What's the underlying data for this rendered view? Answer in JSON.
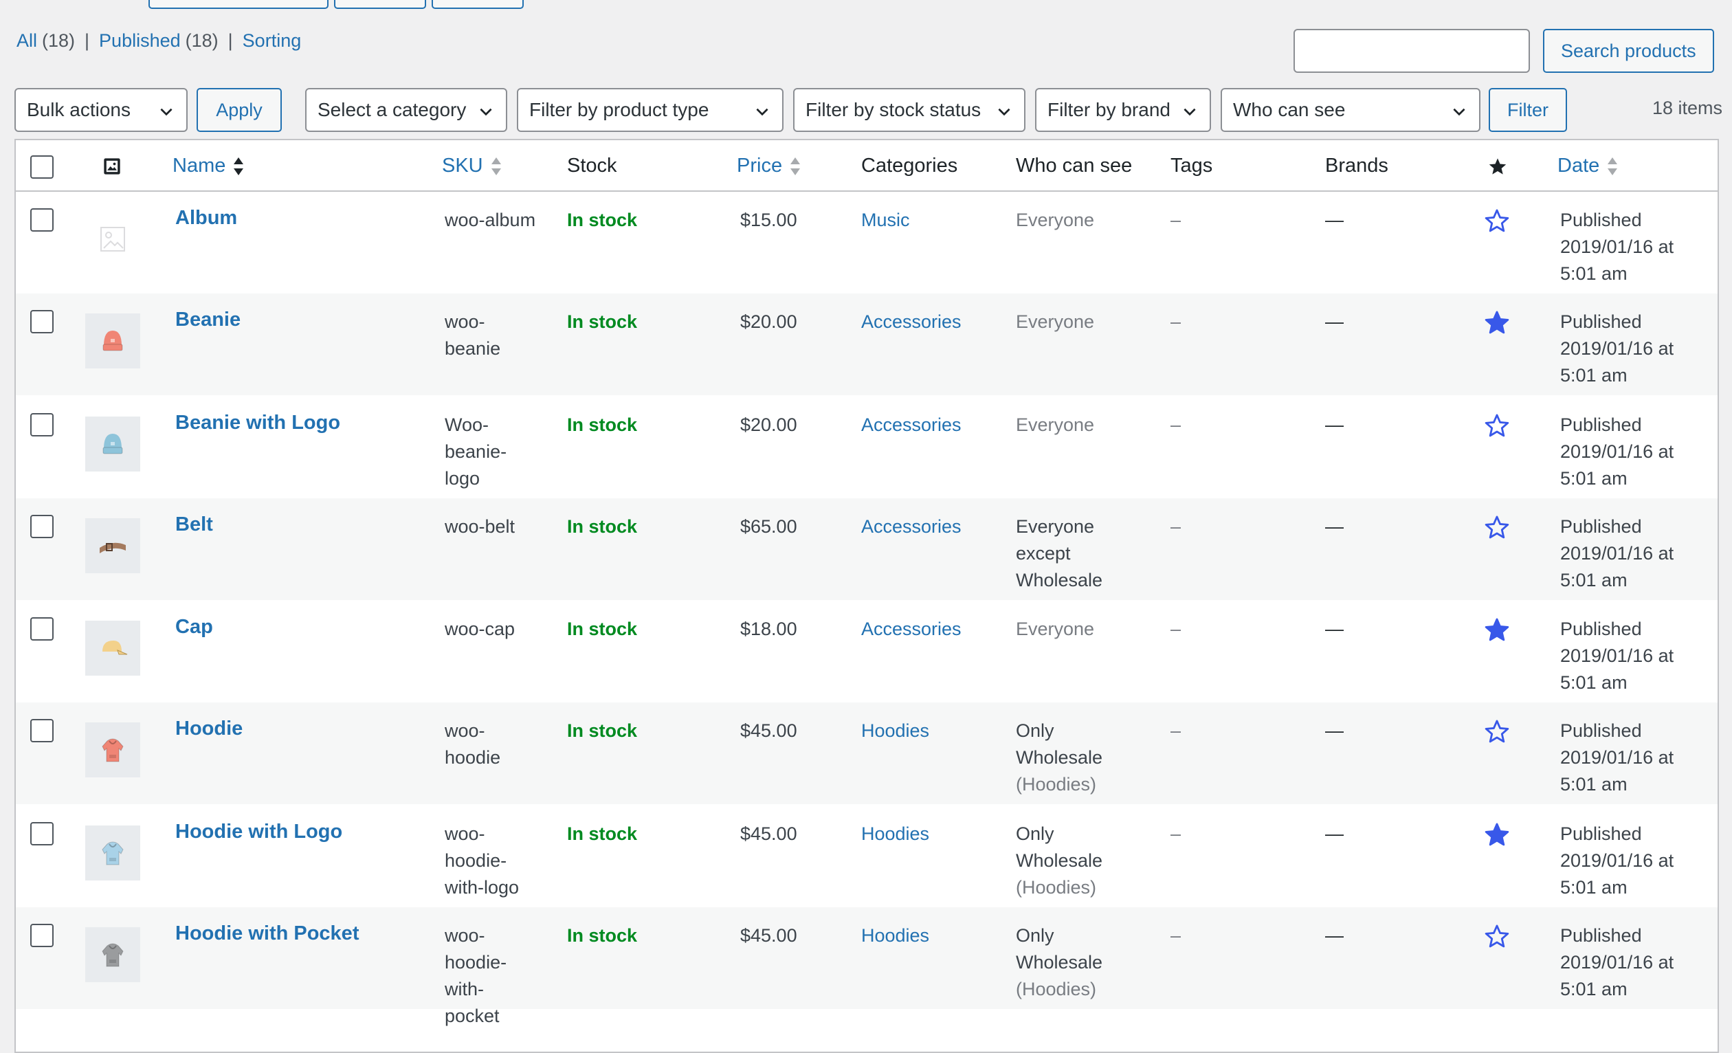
{
  "views": [
    {
      "label": "All",
      "count": "(18)"
    },
    {
      "label": "Published",
      "count": "(18)"
    },
    {
      "label": "Sorting",
      "count": ""
    }
  ],
  "separator": "|",
  "search": {
    "value": "",
    "button": "Search products"
  },
  "filters": {
    "bulk": "Bulk actions",
    "apply": "Apply",
    "category": "Select a category",
    "product_type": "Filter by product type",
    "stock_status": "Filter by stock status",
    "brand": "Filter by brand",
    "who_can_see": "Who can see",
    "filter_button": "Filter"
  },
  "items_count": "18 items",
  "columns": {
    "name": "Name",
    "sku": "SKU",
    "stock": "Stock",
    "price": "Price",
    "categories": "Categories",
    "who": "Who can see",
    "tags": "Tags",
    "brands": "Brands",
    "date": "Date"
  },
  "rows": [
    {
      "name": "Album",
      "sku": [
        "woo-album"
      ],
      "stock": "In stock",
      "price": "$15.00",
      "category": "Music",
      "who": [
        "Everyone"
      ],
      "tags": "–",
      "brands": "—",
      "featured": false,
      "date": [
        "Published",
        "2019/01/16 at",
        "5:01 am"
      ],
      "thumb": "placeholder-image-icon"
    },
    {
      "name": "Beanie",
      "sku": [
        "woo-",
        "beanie"
      ],
      "stock": "In stock",
      "price": "$20.00",
      "category": "Accessories",
      "who": [
        "Everyone"
      ],
      "tags": "–",
      "brands": "—",
      "featured": true,
      "date": [
        "Published",
        "2019/01/16 at",
        "5:01 am"
      ],
      "thumb": "beanie-icon",
      "thumb_color": "#f08575"
    },
    {
      "name": "Beanie with Logo",
      "sku": [
        "Woo-",
        "beanie-",
        "logo"
      ],
      "stock": "In stock",
      "price": "$20.00",
      "category": "Accessories",
      "who": [
        "Everyone"
      ],
      "tags": "–",
      "brands": "—",
      "featured": false,
      "date": [
        "Published",
        "2019/01/16 at",
        "5:01 am"
      ],
      "thumb": "beanie-icon",
      "thumb_color": "#8ec4da"
    },
    {
      "name": "Belt",
      "sku": [
        "woo-belt"
      ],
      "stock": "In stock",
      "price": "$65.00",
      "category": "Accessories",
      "who": [
        "Everyone",
        "except",
        "Wholesale"
      ],
      "tags": "–",
      "brands": "—",
      "featured": false,
      "date": [
        "Published",
        "2019/01/16 at",
        "5:01 am"
      ],
      "thumb": "belt-icon",
      "thumb_color": "#a47a5e"
    },
    {
      "name": "Cap",
      "sku": [
        "woo-cap"
      ],
      "stock": "In stock",
      "price": "$18.00",
      "category": "Accessories",
      "who": [
        "Everyone"
      ],
      "tags": "–",
      "brands": "—",
      "featured": true,
      "date": [
        "Published",
        "2019/01/16 at",
        "5:01 am"
      ],
      "thumb": "cap-icon",
      "thumb_color": "#f3d18b"
    },
    {
      "name": "Hoodie",
      "sku": [
        "woo-",
        "hoodie"
      ],
      "stock": "In stock",
      "price": "$45.00",
      "category": "Hoodies",
      "who": [
        "Only",
        "Wholesale",
        "(Hoodies)"
      ],
      "tags": "–",
      "brands": "—",
      "featured": false,
      "date": [
        "Published",
        "2019/01/16 at",
        "5:01 am"
      ],
      "thumb": "hoodie-icon",
      "thumb_color": "#f08575"
    },
    {
      "name": "Hoodie with Logo",
      "sku": [
        "woo-",
        "hoodie-",
        "with-logo"
      ],
      "stock": "In stock",
      "price": "$45.00",
      "category": "Hoodies",
      "who": [
        "Only",
        "Wholesale",
        "(Hoodies)"
      ],
      "tags": "–",
      "brands": "—",
      "featured": true,
      "date": [
        "Published",
        "2019/01/16 at",
        "5:01 am"
      ],
      "thumb": "hoodie-icon",
      "thumb_color": "#a9d2e8"
    },
    {
      "name": "Hoodie with Pocket",
      "sku": [
        "woo-",
        "hoodie-",
        "with-",
        "pocket"
      ],
      "stock": "In stock",
      "price": "$45.00",
      "category": "Hoodies",
      "who": [
        "Only",
        "Wholesale",
        "(Hoodies)"
      ],
      "tags": "–",
      "brands": "—",
      "featured": false,
      "date": [
        "Published",
        "2019/01/16 at",
        "5:01 am"
      ],
      "thumb": "hoodie-icon",
      "thumb_color": "#9a9c9e"
    }
  ],
  "colors": {
    "link": "#2271b1",
    "in_stock": "#008a20",
    "star": "#3858e9"
  }
}
